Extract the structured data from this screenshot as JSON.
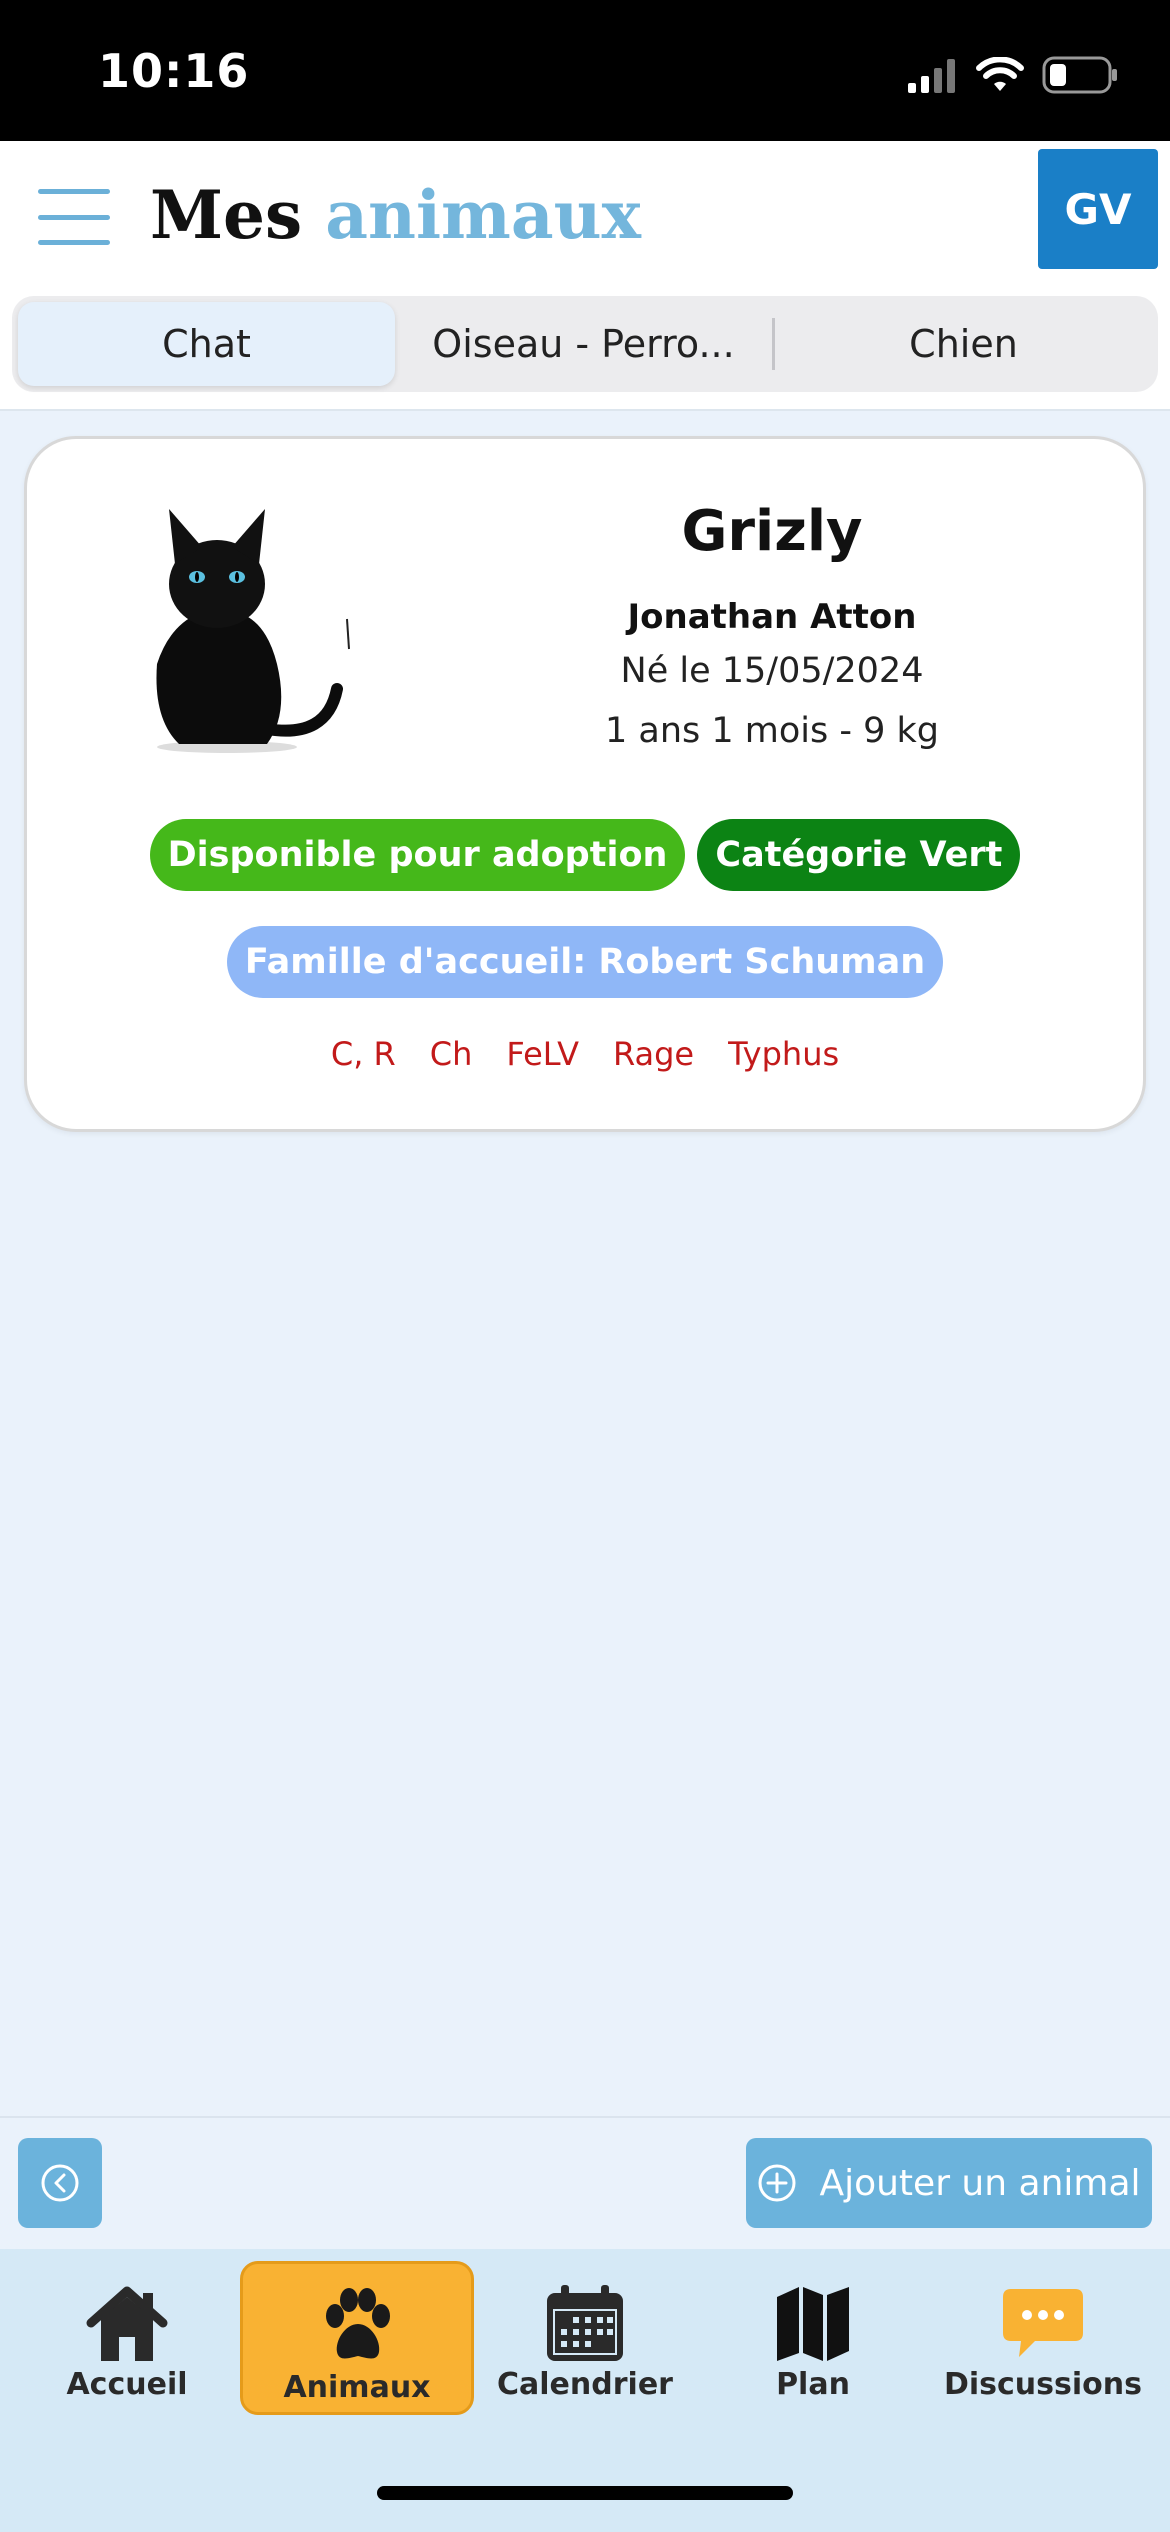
{
  "status_bar": {
    "time": "10:16"
  },
  "header": {
    "title_part1": "Mes",
    "title_part2": "animaux",
    "avatar_initials": "GV"
  },
  "tabs": [
    {
      "label": "Chat",
      "active": true
    },
    {
      "label": "Oiseau - Perro...",
      "active": false
    },
    {
      "label": "Chien",
      "active": false
    }
  ],
  "animal": {
    "name": "Grizly",
    "owner": "Jonathan Atton",
    "birth": "Né le 15/05/2024",
    "age_weight": "1 ans 1 mois - 9 kg",
    "badges": [
      {
        "label": "Disponible pour adoption",
        "color": "#45b81a"
      },
      {
        "label": "Catégorie Vert",
        "color": "#0c8314"
      }
    ],
    "foster": "Famille d'accueil: Robert Schuman",
    "vaccines": [
      "C, R",
      "Ch",
      "FeLV",
      "Rage",
      "Typhus"
    ]
  },
  "actions": {
    "add_label": "Ajouter un animal"
  },
  "tabbar": [
    {
      "label": "Accueil",
      "icon": "home-icon",
      "active": false
    },
    {
      "label": "Animaux",
      "icon": "paw-icon",
      "active": true
    },
    {
      "label": "Calendrier",
      "icon": "calendar-icon",
      "active": false
    },
    {
      "label": "Plan",
      "icon": "map-icon",
      "active": false
    },
    {
      "label": "Discussions",
      "icon": "chat-bubble-icon",
      "active": false
    }
  ],
  "colors": {
    "accent": "#1a7fc7",
    "active_tab": "#f9b233",
    "alert_text": "#c21a1a"
  }
}
